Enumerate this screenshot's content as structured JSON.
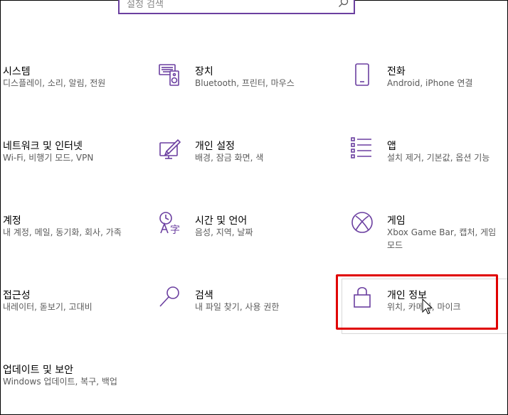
{
  "search": {
    "placeholder": "설정 검색",
    "icon": "search-icon"
  },
  "items": [
    {
      "title": "시스템",
      "desc": "디스플레이, 소리, 알림, 전원",
      "icon": "none"
    },
    {
      "title": "장치",
      "desc": "Bluetooth, 프린터, 마우스",
      "icon": "keyboard-speaker-icon"
    },
    {
      "title": "전화",
      "desc": "Android, iPhone 연결",
      "icon": "phone-icon"
    },
    {
      "title": "네트워크 및 인터넷",
      "desc": "Wi-Fi, 비행기 모드, VPN",
      "icon": "none"
    },
    {
      "title": "개인 설정",
      "desc": "배경, 잠금 화면, 색",
      "icon": "paint-brush-screen-icon"
    },
    {
      "title": "앱",
      "desc": "설치 제거, 기본값, 옵션 기능",
      "icon": "apps-list-icon"
    },
    {
      "title": "계정",
      "desc": "내 계정, 메일, 동기화, 회사, 가족",
      "icon": "none"
    },
    {
      "title": "시간 및 언어",
      "desc": "음성, 지역, 날짜",
      "icon": "time-language-icon"
    },
    {
      "title": "게임",
      "desc": "Xbox Game Bar, 캡처, 게임 모드",
      "icon": "xbox-icon"
    },
    {
      "title": "접근성",
      "desc": "내레이터, 돋보기, 고대비",
      "icon": "none"
    },
    {
      "title": "검색",
      "desc": "내 파일 찾기, 사용 권한",
      "icon": "search-magnifier-icon"
    },
    {
      "title": "개인 정보",
      "desc": "위치, 카메라, 마이크",
      "icon": "lock-icon"
    },
    {
      "title": "업데이트 및 보안",
      "desc": "Windows 업데이트, 복구, 백업",
      "icon": "none"
    }
  ],
  "colors": {
    "accent": "#6b3fa0",
    "highlight": "#e00000"
  }
}
